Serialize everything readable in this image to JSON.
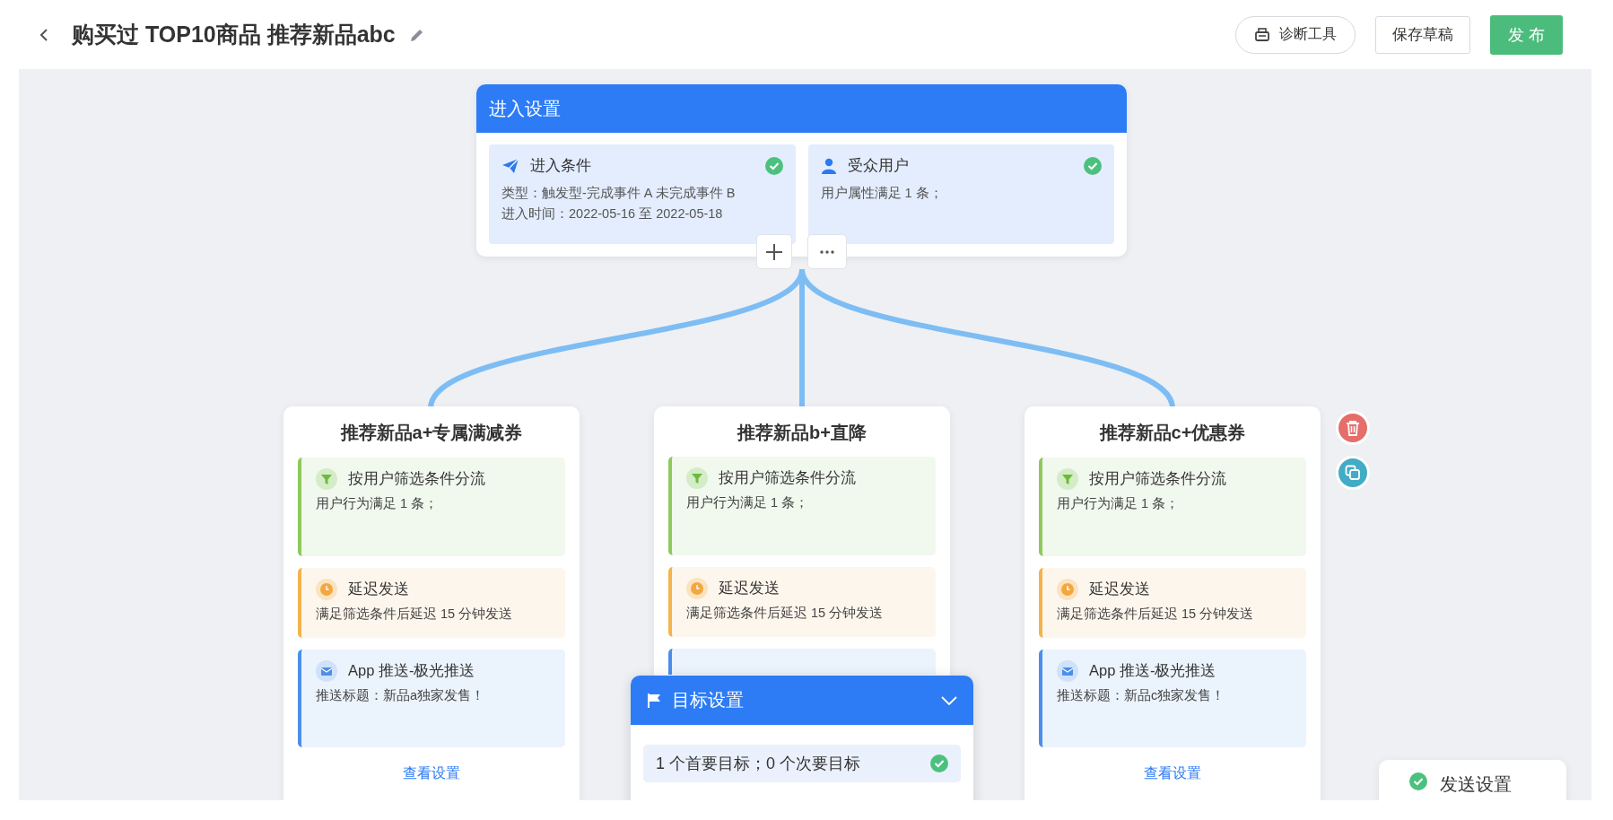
{
  "header": {
    "title": "购买过 TOP10商品 推荐新品abc",
    "buttons": [
      {
        "kind": "tool",
        "label": "诊断工具"
      },
      {
        "kind": "default",
        "label": "保存草稿"
      },
      {
        "kind": "primary",
        "label": "发 布"
      }
    ]
  },
  "entry": {
    "title": "进入设置",
    "items": [
      {
        "kind": "condition",
        "title": "进入条件",
        "lines": [
          "类型：触发型-完成事件 A 未完成事件 B",
          "进入时间：2022-05-16 至 2022-05-18"
        ],
        "done": true
      },
      {
        "kind": "audience",
        "title": "受众用户",
        "lines": [
          "用户属性满足 1 条；"
        ],
        "done": true
      }
    ]
  },
  "branches": [
    {
      "title": "推荐新品a+专属满减券",
      "selected": false,
      "link": "查看设置",
      "steps": [
        {
          "kind": "filter",
          "title": "按用户筛选条件分流",
          "detail": "用户行为满足 1 条；"
        },
        {
          "kind": "delay",
          "title": "延迟发送",
          "detail": "满足筛选条件后延迟 15 分钟发送"
        },
        {
          "kind": "push",
          "title": "App 推送-极光推送",
          "detail": "推送标题：新品a独家发售！"
        }
      ]
    },
    {
      "title": "推荐新品b+直降",
      "selected": false,
      "steps": [
        {
          "kind": "filter",
          "title": "按用户筛选条件分流",
          "detail": "用户行为满足 1 条；"
        },
        {
          "kind": "delay",
          "title": "延迟发送",
          "detail": "满足筛选条件后延迟 15 分钟发送"
        },
        {
          "kind": "push"
        }
      ]
    },
    {
      "title": "推荐新品c+优惠券",
      "selected": true,
      "link": "查看设置",
      "steps": [
        {
          "kind": "filter",
          "title": "按用户筛选条件分流",
          "detail": "用户行为满足 1 条；"
        },
        {
          "kind": "delay",
          "title": "延迟发送",
          "detail": "满足筛选条件后延迟 15 分钟发送"
        },
        {
          "kind": "push",
          "title": "App 推送-极光推送",
          "detail": "推送标题：新品c独家发售！"
        }
      ]
    }
  ],
  "goal": {
    "title": "目标设置",
    "summary": "1 个首要目标；0 个次要目标",
    "done": true
  },
  "send_settings": {
    "label": "发送设置",
    "done": true
  }
}
